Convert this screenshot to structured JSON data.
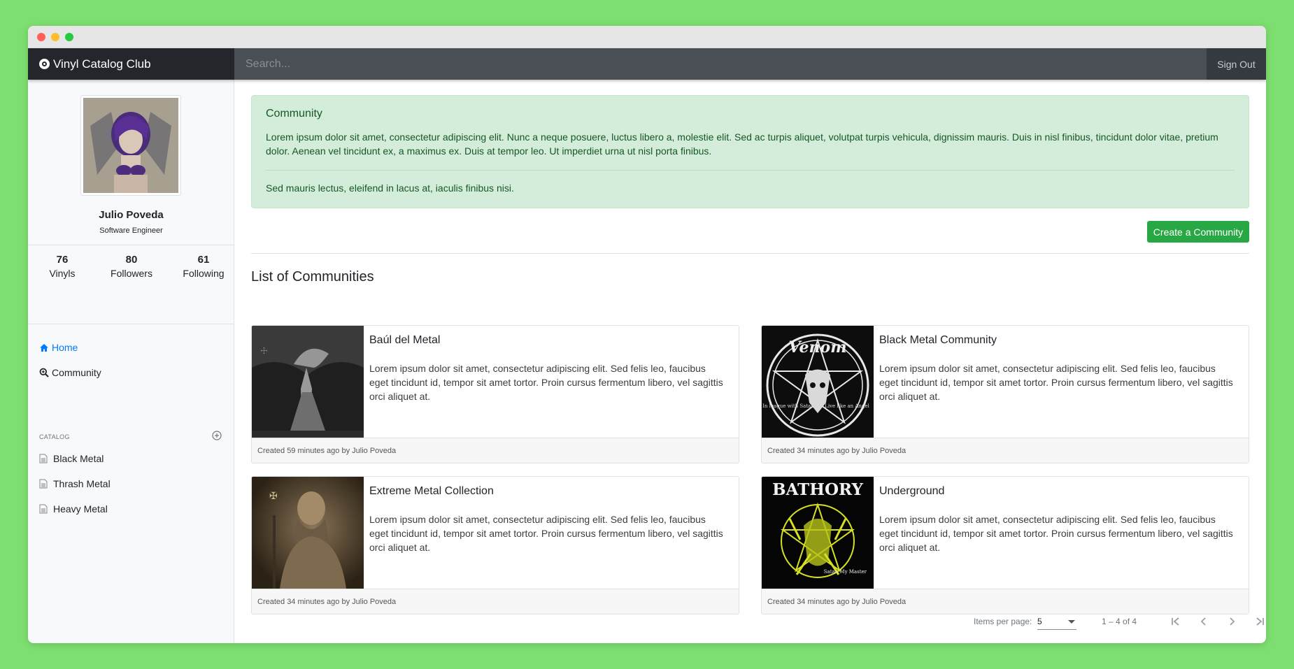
{
  "app": {
    "brand": "Vinyl Catalog Club",
    "search_placeholder": "Search...",
    "sign_out": "Sign Out"
  },
  "profile": {
    "name": "Julio Poveda",
    "role": "Software Engineer",
    "stats": [
      {
        "value": "76",
        "label": "Vinyls"
      },
      {
        "value": "80",
        "label": "Followers"
      },
      {
        "value": "61",
        "label": "Following"
      }
    ]
  },
  "nav": {
    "home": "Home",
    "community": "Community"
  },
  "catalog": {
    "heading": "CATALOG",
    "items": [
      "Black Metal",
      "Thrash Metal",
      "Heavy Metal"
    ]
  },
  "alert": {
    "title": "Community",
    "body": "Lorem ipsum dolor sit amet, consectetur adipiscing elit. Nunc a neque posuere, luctus libero a, molestie elit. Sed ac turpis aliquet, volutpat turpis vehicula, dignissim mauris. Duis in nisl finibus, tincidunt dolor vitae, pretium dolor. Aenean vel tincidunt ex, a maximus ex. Duis at tempor leo. Ut imperdiet urna ut nisl porta finibus.",
    "footer": "Sed mauris lectus, eleifend in lacus at, iaculis finibus nisi."
  },
  "create_button": "Create a Community",
  "list_title": "List of Communities",
  "communities": [
    {
      "title": "Baúl del Metal",
      "text": "Lorem ipsum dolor sit amet, consectetur adipiscing elit. Sed felis leo, faucibus eget tincidunt id, tempor sit amet tortor. Proin cursus fermentum libero, vel sagittis orci aliquet at.",
      "footer": "Created 59 minutes ago by Julio Poveda"
    },
    {
      "title": "Black Metal Community",
      "text": "Lorem ipsum dolor sit amet, consectetur adipiscing elit. Sed felis leo, faucibus eget tincidunt id, tempor sit amet tortor. Proin cursus fermentum libero, vel sagittis orci aliquet at.",
      "footer": "Created 34 minutes ago by Julio Poveda"
    },
    {
      "title": "Extreme Metal Collection",
      "text": "Lorem ipsum dolor sit amet, consectetur adipiscing elit. Sed felis leo, faucibus eget tincidunt id, tempor sit amet tortor. Proin cursus fermentum libero, vel sagittis orci aliquet at.",
      "footer": "Created 34 minutes ago by Julio Poveda"
    },
    {
      "title": "Underground",
      "text": "Lorem ipsum dolor sit amet, consectetur adipiscing elit. Sed felis leo, faucibus eget tincidunt id, tempor sit amet tortor. Proin cursus fermentum libero, vel sagittis orci aliquet at.",
      "footer": "Created 34 minutes ago by Julio Poveda"
    }
  ],
  "album_art": {
    "venom_top": "Venom",
    "venom_left": "In league with Satan",
    "venom_right": "Live like an Angel",
    "bathory_title": "BATHORY",
    "bathory_sub": "Satan My Master"
  },
  "paginator": {
    "label": "Items per page:",
    "page_size": "5",
    "range": "1 – 4 of 4"
  },
  "colors": {
    "accent": "#007bff",
    "success": "#28a745",
    "navbar": "#343a40",
    "background": "#7ddf6f"
  }
}
